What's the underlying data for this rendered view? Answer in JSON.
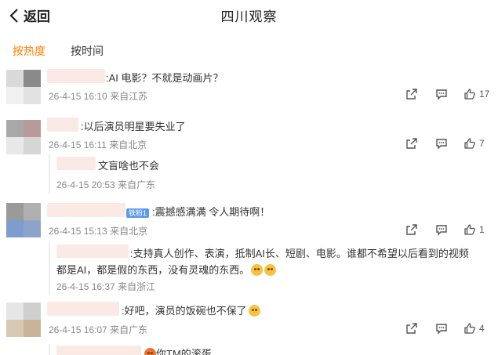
{
  "header": {
    "back_label": "返回",
    "title": "四川观察"
  },
  "sort_tabs": {
    "hot": "按热度",
    "time": "按时间"
  },
  "comments": [
    {
      "text": ":AI 电影？不就是动画片？",
      "date": "26-4-15 16:10",
      "location": "来自江苏",
      "likes": "17"
    },
    {
      "text": ":以后演员明星要失业了",
      "date": "26-4-15 16:11",
      "location": "来自北京",
      "likes": "7",
      "reply": {
        "text": "文盲啥也不会",
        "date": "26-4-15 20:53",
        "location": "来自广东"
      }
    },
    {
      "badge": "铁粉1",
      "text": ":震撼感满满 令人期待啊！",
      "date": "26-4-15 15:13",
      "location": "来自北京",
      "likes": "1",
      "reply": {
        "text_line1": ":支持真人创作、表演，抵制AI长、短剧、电影。谁都不希望以后看到的视频",
        "text_line2": "都是AI，都是假的东西，没有灵魂的东西。",
        "date": "26-4-15 16:37",
        "location": "来自浙江"
      }
    },
    {
      "text": ":好吧，演员的饭碗也不保了",
      "date": "26-4-15 16:07",
      "location": "来自广东",
      "likes": "4",
      "reply": {
        "text": "你TM的滚蛋"
      }
    }
  ],
  "colors": {
    "accent": "#ff8200",
    "meta": "#888888",
    "badge": "#5a9be8"
  },
  "icons": {
    "back": "chevron-left-icon",
    "share": "share-icon",
    "reply": "comment-icon",
    "like": "thumbs-up-icon"
  }
}
